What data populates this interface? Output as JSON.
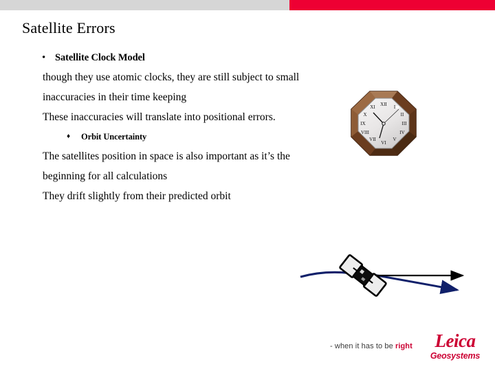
{
  "header": {
    "bar_gray_color": "#d6d6d6",
    "bar_red_color": "#ee0033"
  },
  "slide": {
    "title": "Satellite Errors"
  },
  "content": {
    "blocks": [
      {
        "kind": "bullet1",
        "bullet": "•",
        "text": "Satellite Clock Model"
      },
      {
        "kind": "para",
        "text": "though they use atomic clocks, they are still subject to small"
      },
      {
        "kind": "para",
        "text": "inaccuracies in their time keeping"
      },
      {
        "kind": "para",
        "text": "These inaccuracies will translate into positional errors."
      },
      {
        "kind": "bullet2",
        "bullet": "♦",
        "text": "Orbit Uncertainty"
      },
      {
        "kind": "para",
        "text": "The satellites position in space is also important as it’s the"
      },
      {
        "kind": "para",
        "text": "beginning for all calculations"
      },
      {
        "kind": "para",
        "text": "They drift slightly from their predicted orbit"
      }
    ]
  },
  "images": {
    "clock": {
      "name": "octagonal-wall-clock",
      "frame_color": "#7a4a2a",
      "frame_light_color": "#a87a55",
      "frame_dark_color": "#5c3418",
      "face_color": "#eceaea",
      "numerals": [
        "XII",
        "I",
        "II",
        "III",
        "IV",
        "V",
        "VI",
        "VII",
        "VIII",
        "IX",
        "X",
        "XI"
      ]
    },
    "satellite": {
      "name": "satellite-with-orbit-arrows",
      "body_color": "#111111",
      "panel_color": "#e8e8e8",
      "orbit_arrow_color": "#10206a",
      "straight_arrow_color": "#000000"
    }
  },
  "footer": {
    "tagline_prefix": "- when it has to be ",
    "tagline_highlight": "right",
    "brand_name": "Leica",
    "brand_sub": "Geosystems",
    "brand_color": "#cc0033"
  }
}
